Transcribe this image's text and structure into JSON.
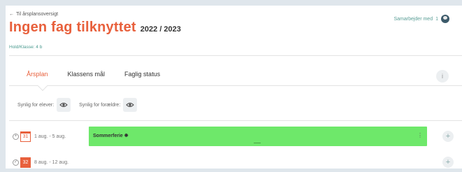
{
  "header": {
    "back_link": "Til årsplansoversigt",
    "title": "Ingen fag tilknyttet",
    "year": "2022 / 2023",
    "class_label": "Hold/Klasse: 4 b",
    "collab_label": "Samarbejder med",
    "collab_count": "1"
  },
  "tabs": [
    {
      "label": "Årsplan",
      "active": true
    },
    {
      "label": "Klassens mål",
      "active": false
    },
    {
      "label": "Faglig status",
      "active": false
    }
  ],
  "visibility": {
    "students_label": "Synlig for elever:",
    "parents_label": "Synlig for forældre:"
  },
  "weeks": [
    {
      "number": "31",
      "dates": "1 aug. - 5 aug.",
      "event": "Sommerferie"
    },
    {
      "number": "32",
      "dates": "8 aug. - 12 aug."
    }
  ],
  "colors": {
    "accent": "#e8603c",
    "event_green": "#6ee86a",
    "teal": "#4a9a8f"
  },
  "icons": [
    "arrow-left-icon",
    "avatar-icon",
    "info-icon",
    "eye-icon",
    "calendar-icon",
    "plus-icon",
    "kebab-menu-icon"
  ]
}
